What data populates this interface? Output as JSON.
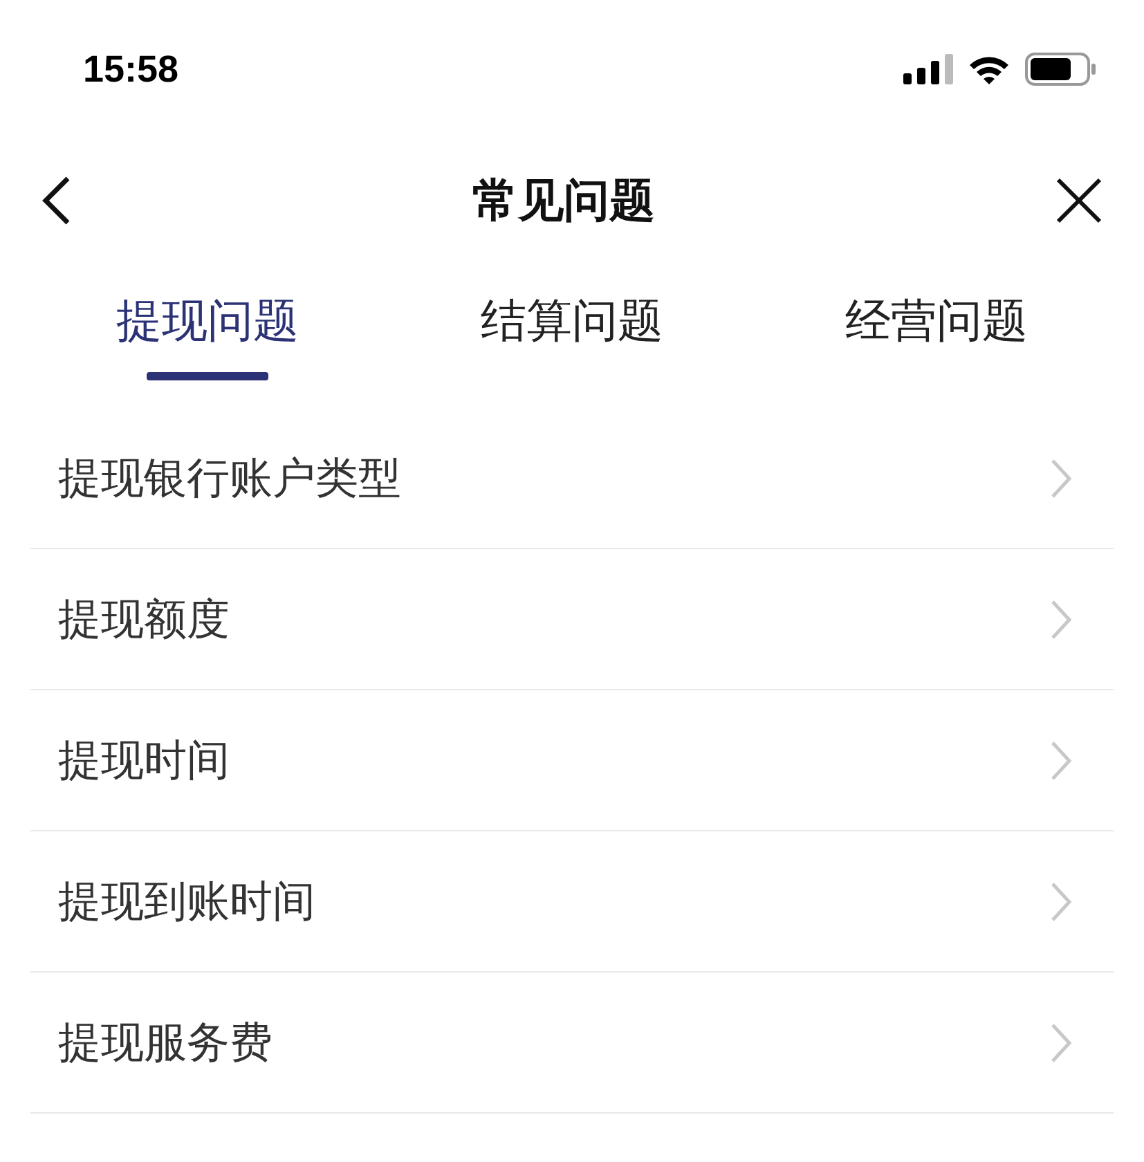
{
  "status_bar": {
    "time": "15:58"
  },
  "nav": {
    "title": "常见问题"
  },
  "tabs": [
    {
      "label": "提现问题",
      "selected": true
    },
    {
      "label": "结算问题",
      "selected": false
    },
    {
      "label": "经营问题",
      "selected": false
    }
  ],
  "items": [
    {
      "label": "提现银行账户类型"
    },
    {
      "label": "提现额度"
    },
    {
      "label": "提现时间"
    },
    {
      "label": "提现到账时间"
    },
    {
      "label": "提现服务费"
    }
  ]
}
